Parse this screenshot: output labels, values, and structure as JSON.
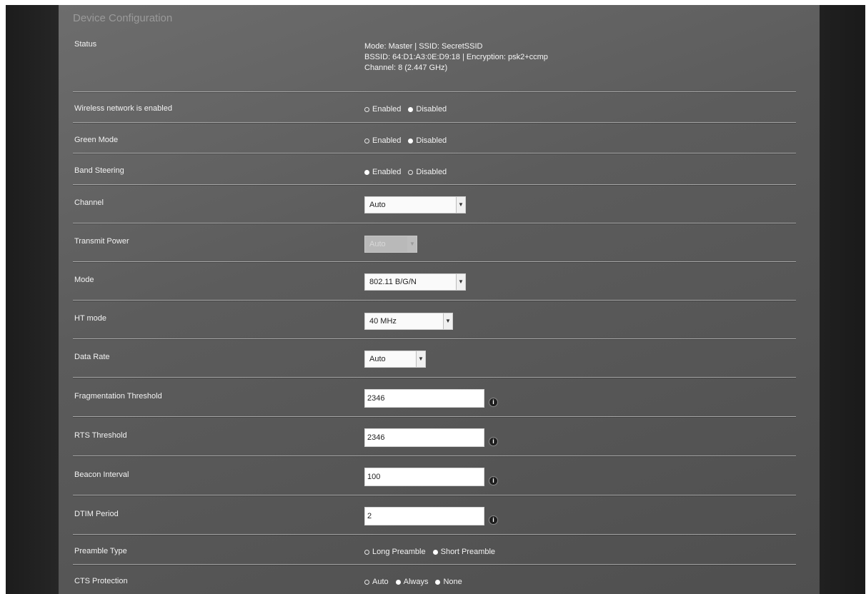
{
  "page": {
    "title": "Device Configuration"
  },
  "status": {
    "label": "Status",
    "lines": [
      "Mode: Master | SSID: SecretSSID",
      "BSSID: 64:D1:A3:0E:D9:18 | Encryption: psk2+ccmp",
      "Channel: 8 (2.447 GHz)"
    ]
  },
  "rows": {
    "wireless": {
      "label": "Wireless network is enabled",
      "options": [
        "Enabled",
        "Disabled"
      ],
      "selected": "Disabled"
    },
    "green_mode": {
      "label": "Green Mode",
      "options": [
        "Enabled",
        "Disabled"
      ],
      "selected": "Disabled"
    },
    "band_steering": {
      "label": "Band Steering",
      "options": [
        "Enabled",
        "Disabled"
      ],
      "selected": "Enabled"
    },
    "channel": {
      "label": "Channel",
      "value": "Auto"
    },
    "transmit_power": {
      "label": "Transmit Power",
      "value": "Auto"
    },
    "mode": {
      "label": "Mode",
      "value": "802.11 B/G/N"
    },
    "ht_mode": {
      "label": "HT mode",
      "value": "40 MHz"
    },
    "data_rate": {
      "label": "Data Rate",
      "value": "Auto"
    },
    "frag_threshold": {
      "label": "Fragmentation Threshold",
      "value": "2346"
    },
    "rts_threshold": {
      "label": "RTS Threshold",
      "value": "2346"
    },
    "beacon_interval": {
      "label": "Beacon Interval",
      "value": "100"
    },
    "dtim_period": {
      "label": "DTIM Period",
      "value": "2"
    },
    "preamble_type": {
      "label": "Preamble Type",
      "options": [
        "Long Preamble",
        "Short Preamble"
      ],
      "selected": "Short Preamble"
    },
    "cts_protection": {
      "label": "CTS Protection",
      "options": [
        "Auto",
        "Always",
        "None"
      ],
      "selected": [
        "Always",
        "None"
      ]
    }
  },
  "icons": {
    "info": "info-icon",
    "dropdown": "chevron-down-icon",
    "info_glyph": "i",
    "dropdown_glyph": "▼"
  }
}
